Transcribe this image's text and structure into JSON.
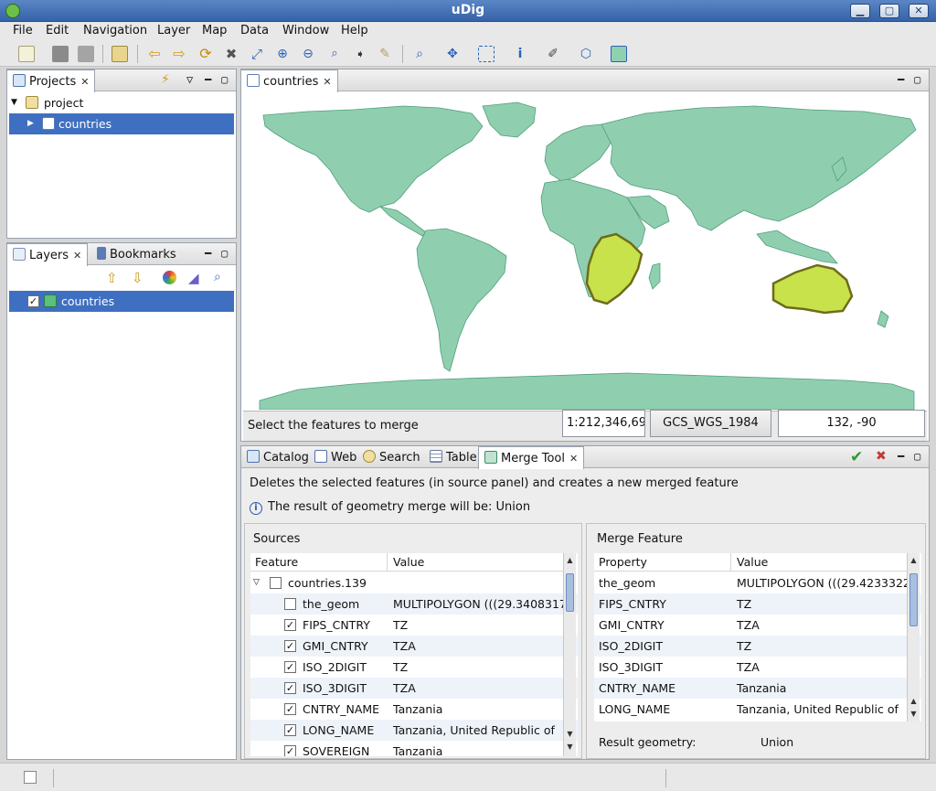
{
  "window": {
    "title": "uDig"
  },
  "menu": [
    "File",
    "Edit",
    "Navigation",
    "Layer",
    "Map",
    "Data",
    "Window",
    "Help"
  ],
  "projects_panel": {
    "tab_label": "Projects",
    "tree": [
      {
        "label": "project",
        "expanded": true
      },
      {
        "label": "countries",
        "selected": true
      }
    ]
  },
  "layers_panel": {
    "tabs": [
      "Layers",
      "Bookmarks"
    ],
    "items": [
      {
        "label": "countries",
        "checked": true,
        "selected": true
      }
    ]
  },
  "map_editor": {
    "tab_label": "countries",
    "status_text": "Select the features to merge",
    "scale": "1:212,346,69",
    "crs": "GCS_WGS_1984",
    "coords": "132, -90",
    "colors": {
      "land": "#8fcfb0",
      "selected": "#c7e24a",
      "selected_outline": "#6f6b1a",
      "border": "#4f9e7a"
    }
  },
  "bottom_tabs": [
    "Catalog",
    "Web",
    "Search",
    "Table",
    "Merge Tool"
  ],
  "merge_tool": {
    "description": "Deletes the selected features (in source panel) and creates a new merged feature",
    "info_text": "The result of geometry merge will be: Union",
    "sources": {
      "heading": "Sources",
      "columns": [
        "Feature",
        "Value"
      ],
      "group": {
        "label": "countries.139",
        "checked": false
      },
      "rows": [
        {
          "feature": "the_geom",
          "value": "MULTIPOLYGON (((29.3408317",
          "checked": false
        },
        {
          "feature": "FIPS_CNTRY",
          "value": "TZ",
          "checked": true
        },
        {
          "feature": "GMI_CNTRY",
          "value": "TZA",
          "checked": true
        },
        {
          "feature": "ISO_2DIGIT",
          "value": "TZ",
          "checked": true
        },
        {
          "feature": "ISO_3DIGIT",
          "value": "TZA",
          "checked": true
        },
        {
          "feature": "CNTRY_NAME",
          "value": "Tanzania",
          "checked": true
        },
        {
          "feature": "LONG_NAME",
          "value": "Tanzania, United Republic of",
          "checked": true
        },
        {
          "feature": "SOVEREIGN",
          "value": "Tanzania",
          "checked": true
        }
      ]
    },
    "merge_feature": {
      "heading": "Merge Feature",
      "columns": [
        "Property",
        "Value"
      ],
      "rows": [
        {
          "property": "the_geom",
          "value": "MULTIPOLYGON (((29.4233322"
        },
        {
          "property": "FIPS_CNTRY",
          "value": "TZ"
        },
        {
          "property": "GMI_CNTRY",
          "value": "TZA"
        },
        {
          "property": "ISO_2DIGIT",
          "value": "TZ"
        },
        {
          "property": "ISO_3DIGIT",
          "value": "TZA"
        },
        {
          "property": "CNTRY_NAME",
          "value": "Tanzania"
        },
        {
          "property": "LONG_NAME",
          "value": "Tanzania, United Republic of"
        }
      ],
      "result_label": "Result geometry:",
      "result_value": "Union"
    }
  }
}
